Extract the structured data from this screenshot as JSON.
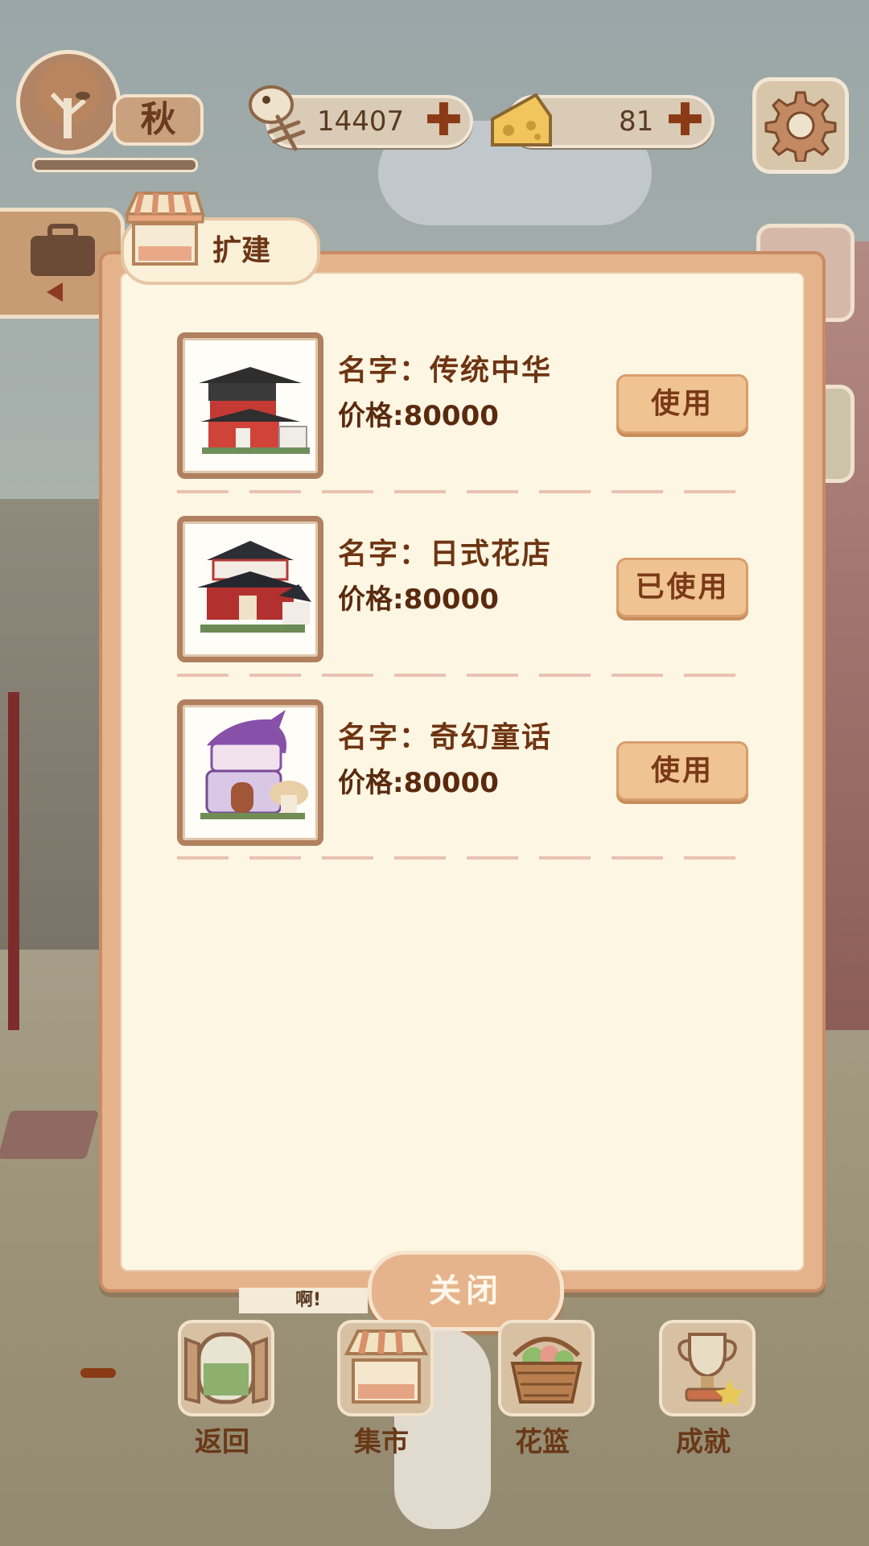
{
  "hud": {
    "season": "秋",
    "fish_count": "14407",
    "cheese_count": "81",
    "plus_symbol": "✚"
  },
  "dialog": {
    "title": "扩建",
    "items": [
      {
        "name": "名字：传统中华",
        "price": "价格:80000",
        "action": "使用"
      },
      {
        "name": "名字：日式花店",
        "price": "价格:80000",
        "action": "已使用"
      },
      {
        "name": "名字：奇幻童话",
        "price": "价格:80000",
        "action": "使用"
      }
    ],
    "close_label": "关闭"
  },
  "speech_text": "啊!",
  "nav": [
    {
      "label": "返回",
      "icon": "window-icon"
    },
    {
      "label": "集市",
      "icon": "market-stall-icon"
    },
    {
      "label": "花篮",
      "icon": "flower-basket-icon"
    },
    {
      "label": "成就",
      "icon": "trophy-icon"
    }
  ],
  "colors": {
    "dialog_frame": "#e4b28b",
    "dialog_paper": "#fdf6e3",
    "text_brown": "#6e3412",
    "button_fill": "#f0c393"
  }
}
